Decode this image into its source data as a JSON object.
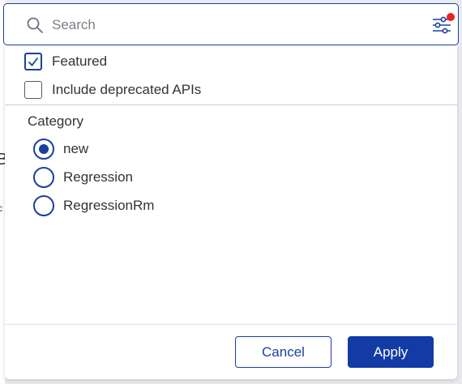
{
  "search": {
    "placeholder": "Search",
    "value": "",
    "filter_active_indicator_color": "#e8221d"
  },
  "filters": {
    "checkboxes": [
      {
        "label": "Featured",
        "checked": true
      },
      {
        "label": "Include deprecated APIs",
        "checked": false
      }
    ],
    "category": {
      "title": "Category",
      "options": [
        {
          "label": "new",
          "selected": true
        },
        {
          "label": "Regression",
          "selected": false
        },
        {
          "label": "RegressionRm",
          "selected": false
        }
      ]
    }
  },
  "actions": {
    "cancel_label": "Cancel",
    "apply_label": "Apply"
  },
  "colors": {
    "accent": "#1a3f9e",
    "primary_button": "#123ba6"
  }
}
